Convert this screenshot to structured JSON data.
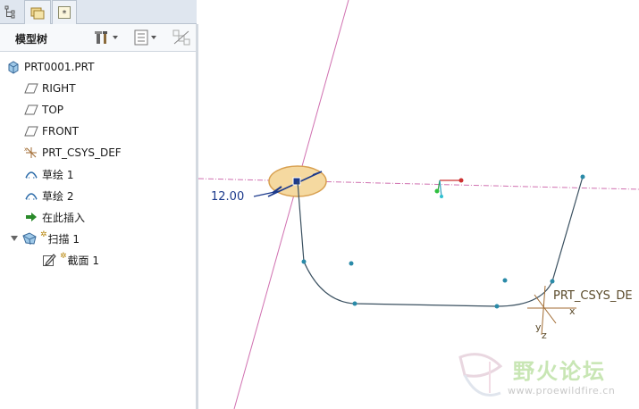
{
  "colors": {
    "panel_bg": "#ffffff",
    "datum_line": "#d070b0",
    "curve": "#3a5060",
    "point": "#2a8aa8",
    "ellipse_fill": "#f5d9a0",
    "ellipse_stroke": "#d8a050",
    "dimension": "#1c3a8c",
    "csys": "#a06a30",
    "watermark_green": "#c8e6b4",
    "watermark_gray": "#c9c9c9"
  },
  "tabs": [
    {
      "icon": "tree-hierarchy-icon"
    },
    {
      "icon": "folder-browser-icon"
    },
    {
      "icon": "favorites-icon"
    }
  ],
  "panel": {
    "title": "模型树",
    "buttons": [
      {
        "icon": "tree-settings-icon"
      },
      {
        "icon": "show-filter-icon"
      },
      {
        "icon": "hidden-visibility-icon"
      }
    ]
  },
  "tree": {
    "items": [
      {
        "label": "PRT0001.PRT",
        "icon": "part-icon"
      },
      {
        "label": "RIGHT",
        "icon": "datum-plane-icon"
      },
      {
        "label": "TOP",
        "icon": "datum-plane-icon"
      },
      {
        "label": "FRONT",
        "icon": "datum-plane-icon"
      },
      {
        "label": "PRT_CSYS_DEF",
        "icon": "coordinate-system-icon"
      },
      {
        "label": "草绘 1",
        "icon": "sketch-icon"
      },
      {
        "label": "草绘 2",
        "icon": "sketch-icon"
      },
      {
        "label": "在此插入",
        "icon": "insert-here-arrow-icon"
      },
      {
        "label": "扫描 1",
        "icon": "sweep-icon",
        "expanded": true,
        "new": true
      },
      {
        "label": "截面 1",
        "icon": "section-pencil-icon",
        "new": true
      }
    ]
  },
  "viewport": {
    "dimension_value": "12.00",
    "csys_label": "PRT_CSYS_DE",
    "axis_x": "x",
    "axis_y": "y",
    "axis_z": "z"
  },
  "watermark": {
    "text": "野火论坛",
    "url": "www.proewildfire.cn"
  }
}
